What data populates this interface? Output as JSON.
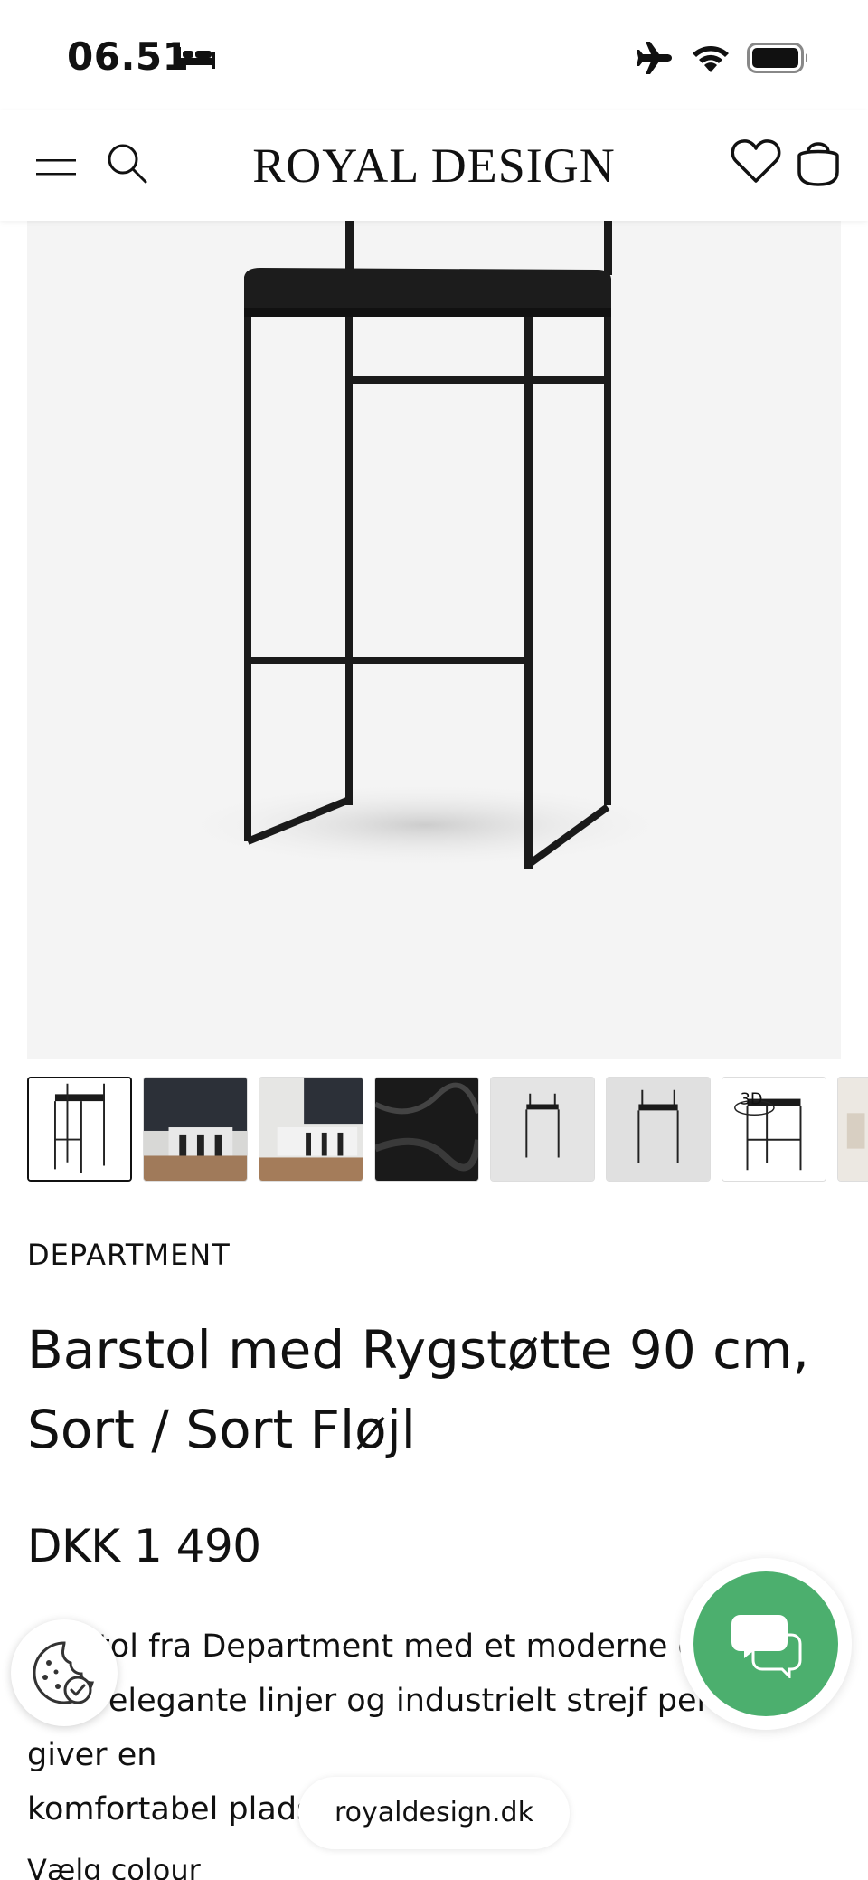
{
  "status_bar": {
    "time": "06.51",
    "icons": [
      "bed-icon",
      "airplane-icon",
      "wifi-icon",
      "battery-icon"
    ]
  },
  "header": {
    "logo": "ROYAL DESIGN",
    "icons": [
      "menu-icon",
      "search-icon",
      "heart-icon",
      "bag-icon"
    ]
  },
  "gallery": {
    "thumbnail_count": 8,
    "active_index": 0,
    "badge_3d": "3D"
  },
  "product": {
    "brand": "DEPARTMENT",
    "title": "Barstol med Rygstøtte 90 cm, Sort / Sort Fløjl",
    "price": "DKK 1 490",
    "description_line1": "Barstol fra Department med et moderne design",
    "description_line2": "hvor elegante linjer og industrielt strejf perfekt giver en",
    "description_line3": "komfortabel plads ved barbordet.",
    "choose_colour_label": "Vælg colour"
  },
  "floating": {
    "url": "royaldesign.dk",
    "chat_color": "#4caf6e"
  }
}
